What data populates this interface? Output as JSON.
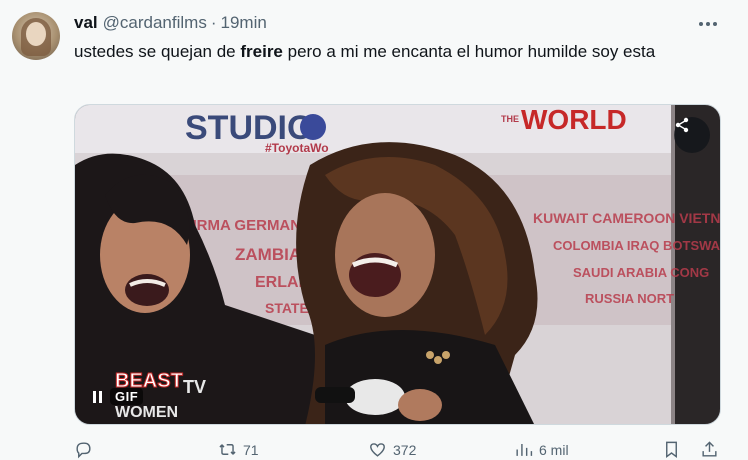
{
  "author": {
    "name": "val",
    "handle": "@cardanfilms",
    "separator": "·",
    "time": "19min"
  },
  "tweet": {
    "text_before": "ustedes se quejan de ",
    "text_bold": "freire",
    "text_after": " pero a mi me encanta el humor humilde soy esta"
  },
  "media": {
    "type": "gif",
    "badge": "GIF",
    "backdrop_texts": {
      "studio": "STUDIO",
      "hashtag": "#ToyotaWo",
      "world": "WORLD",
      "the": "THE",
      "countries_1": "BURMA GERMANY YE",
      "countries_2": "ZAMBIA CHIL",
      "countries_3": "ERLANDS J",
      "countries_4": "STATES",
      "countries_5": "KUWAIT CAMEROON VIETNAM",
      "countries_6": "COLOMBIA IRAQ BOTSWA",
      "countries_7": "SAUDI ARABIA CONG",
      "countries_8": "RUSSIA NORT",
      "beast_1": "BEAST",
      "beast_tv": "TV",
      "beast_2": "WOMEN"
    }
  },
  "actions": {
    "reply": "",
    "retweets": "71",
    "likes": "372",
    "views": "6 mil"
  },
  "colors": {
    "text": "#0f1419",
    "secondary": "#536471",
    "background": "#f7f9f9",
    "accent_red": "#c62828"
  }
}
